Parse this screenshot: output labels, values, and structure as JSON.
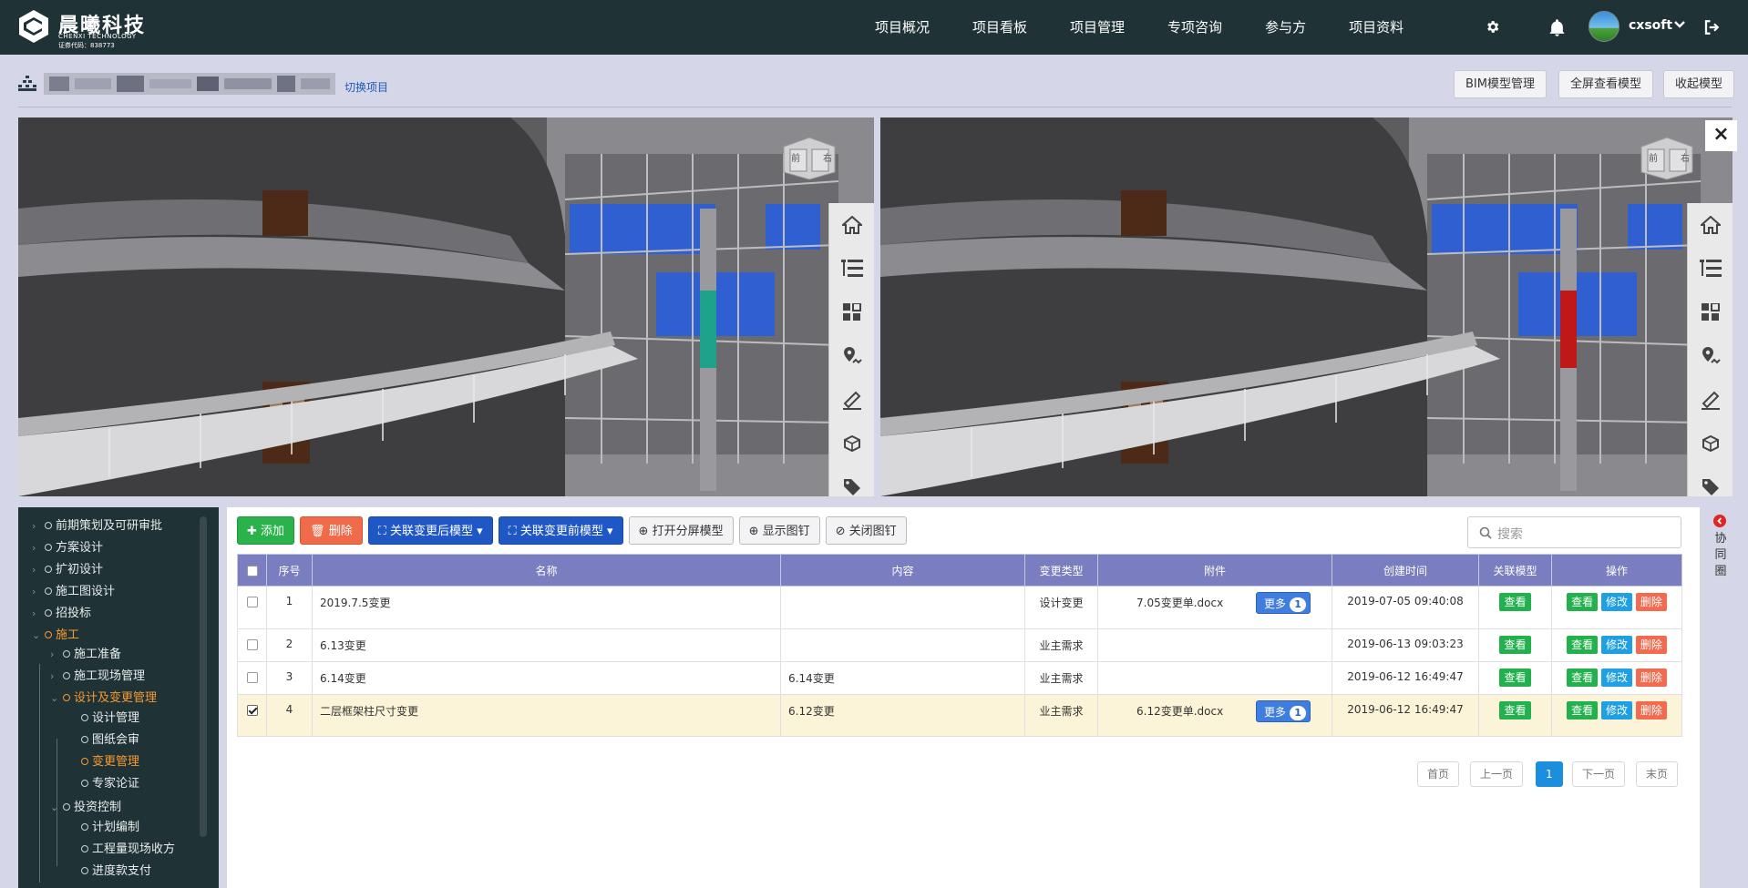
{
  "header": {
    "logo_cn": "晨曦科技",
    "logo_en": "CHENXI TECHNOLOGY",
    "logo_code": "证券代码：838773",
    "nav": [
      "项目概况",
      "项目看板",
      "项目管理",
      "专项咨询",
      "参与方",
      "项目资料"
    ],
    "username": "cxsoft",
    "icons": [
      "gear-icon",
      "bell-icon",
      "chevron-down-icon",
      "logout-icon"
    ]
  },
  "breadcrumb": {
    "switch_label": "切换项目"
  },
  "toolbar_top": {
    "bim_manage": "BIM模型管理",
    "fullscreen": "全屏查看模型",
    "collapse": "收起模型"
  },
  "viewer": {
    "close_label": "×",
    "cube_left": "前",
    "cube_right": "右",
    "tools": [
      "home-icon",
      "tree-icon",
      "components-icon",
      "location-icon",
      "measure-icon",
      "section-box-icon",
      "tag-icon"
    ]
  },
  "tree": {
    "items": [
      {
        "label": "前期策划及可研审批",
        "level": 0,
        "active": false
      },
      {
        "label": "方案设计",
        "level": 0,
        "active": false
      },
      {
        "label": "扩初设计",
        "level": 0,
        "active": false
      },
      {
        "label": "施工图设计",
        "level": 0,
        "active": false
      },
      {
        "label": "招投标",
        "level": 0,
        "active": false
      },
      {
        "label": "施工",
        "level": 0,
        "active": true
      },
      {
        "label": "施工准备",
        "level": 1,
        "active": false
      },
      {
        "label": "施工现场管理",
        "level": 1,
        "active": false
      },
      {
        "label": "设计及变更管理",
        "level": 1,
        "active": true
      },
      {
        "label": "设计管理",
        "level": 2,
        "active": false
      },
      {
        "label": "图纸会审",
        "level": 2,
        "active": false
      },
      {
        "label": "变更管理",
        "level": 2,
        "active": true
      },
      {
        "label": "专家论证",
        "level": 2,
        "active": false
      },
      {
        "label": "投资控制",
        "level": 1,
        "active": false
      },
      {
        "label": "计划编制",
        "level": 2,
        "active": false
      },
      {
        "label": "工程量现场收方",
        "level": 2,
        "active": false
      },
      {
        "label": "进度款支付",
        "level": 2,
        "active": false
      }
    ]
  },
  "actions": {
    "add": "添加",
    "delete": "删除",
    "link_after": "关联变更后模型",
    "link_before": "关联变更前模型",
    "split_screen": "打开分屏模型",
    "show_pins": "显示图钉",
    "hide_pins": "关闭图钉"
  },
  "search": {
    "placeholder": "搜索"
  },
  "table": {
    "headers": [
      "序号",
      "名称",
      "内容",
      "变更类型",
      "附件",
      "创建时间",
      "关联模型",
      "操作"
    ],
    "rows": [
      {
        "no": "1",
        "name": "2019.7.5变更",
        "content": "",
        "type": "设计变更",
        "attachment": "7.05变更单.docx",
        "more": "更多",
        "more_count": "1",
        "created": "2019-07-05 09:40:08",
        "checked": false
      },
      {
        "no": "2",
        "name": "6.13变更",
        "content": "",
        "type": "业主需求",
        "attachment": "",
        "more": "",
        "more_count": "",
        "created": "2019-06-13 09:03:23",
        "checked": false
      },
      {
        "no": "3",
        "name": "6.14变更",
        "content": "6.14变更",
        "type": "业主需求",
        "attachment": "",
        "more": "",
        "more_count": "",
        "created": "2019-06-12 16:49:47",
        "checked": false
      },
      {
        "no": "4",
        "name": "二层框架柱尺寸变更",
        "content": "6.12变更",
        "type": "业主需求",
        "attachment": "6.12变更单.docx",
        "more": "更多",
        "more_count": "1",
        "created": "2019-06-12 16:49:47",
        "checked": true
      }
    ],
    "view_label": "查看",
    "edit_label": "修改",
    "delete_label": "删除"
  },
  "pagination": {
    "first": "首页",
    "prev": "上一页",
    "current": "1",
    "next": "下一页",
    "last": "末页"
  },
  "collab": {
    "label": "协同圈"
  },
  "colors": {
    "topbar": "#1f3236",
    "accent_orange": "#f79a2e",
    "table_header": "#7a7dbf",
    "green": "#22b14c",
    "blue": "#1ea0e2",
    "red": "#f46a4f"
  }
}
